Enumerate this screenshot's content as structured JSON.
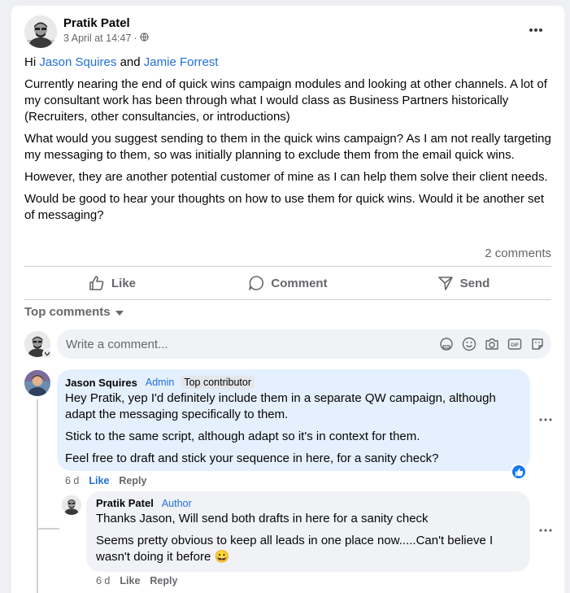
{
  "post": {
    "author": "Pratik Patel",
    "timestamp": "3 April at 14:47",
    "privacy_icon": "globe-icon",
    "greeting_prefix": "Hi",
    "mention_1": "Jason Squires",
    "greeting_and": "and",
    "mention_2": "Jamie Forrest",
    "paragraphs": [
      "Currently nearing the end of quick wins campaign modules and looking at other channels. A lot of my consultant work has been through what I would class as Business Partners historically (Recruiters, other consultancies, or  introductions)",
      "What would you suggest sending to them in the quick wins campaign? As I am not really targeting my messaging to them, so was initially planning to exclude them from the email quick wins.",
      "However, they are another potential customer of mine as I can help them solve their client needs.",
      "Would be good to hear your thoughts on how to use them for quick wins. Would it be another set of messaging?"
    ],
    "comment_count": "2 comments"
  },
  "actions": {
    "like": "Like",
    "comment": "Comment",
    "send": "Send"
  },
  "comments_filter": "Top comments",
  "write_comment": {
    "placeholder": "Write a comment..."
  },
  "comments": [
    {
      "author": "Jason Squires",
      "badge": "Admin",
      "top_badge": "Top contributor",
      "paragraphs": [
        "Hey Pratik, yep I'd definitely include them in a separate QW campaign, although adapt the messaging specifically to them.",
        "Stick to the same script, although adapt so it's in context for them.",
        "Feel free to draft and stick your sequence in here, for a sanity check?"
      ],
      "age": "6 d",
      "like": "Like",
      "reply": "Reply"
    },
    {
      "author": "Pratik Patel",
      "badge": "Author",
      "paragraphs": [
        "Thanks Jason, Will send both drafts in here for a sanity check",
        "Seems pretty obvious to keep all leads in one place now.....Can't believe I wasn't doing it before"
      ],
      "emoji": "😀",
      "age": "6 d",
      "like": "Like",
      "reply": "Reply"
    }
  ],
  "colors": {
    "link": "#216fdb",
    "like_blue": "#1877f2",
    "bubble": "#f0f2f5",
    "bubble_highlight": "#e4f0fd",
    "muted": "#65676b"
  }
}
